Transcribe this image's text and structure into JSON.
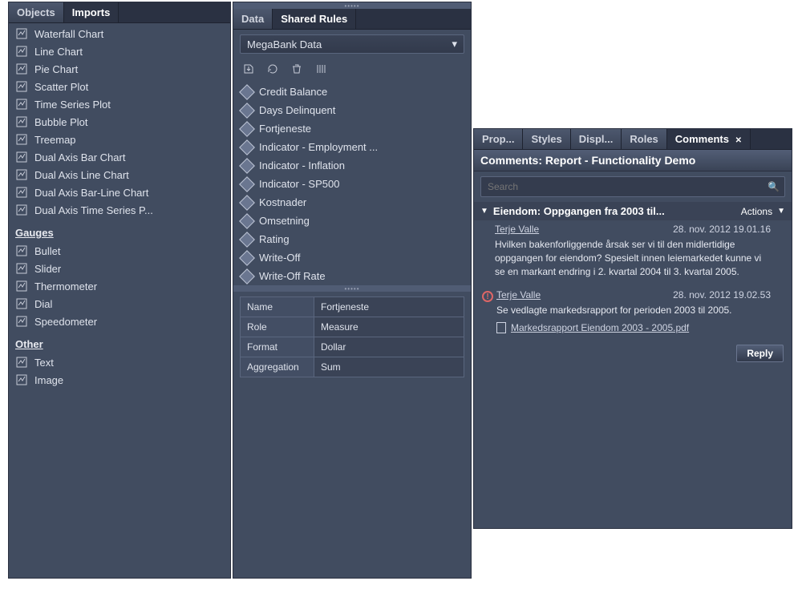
{
  "objects_panel": {
    "tabs": [
      {
        "label": "Objects",
        "active": false
      },
      {
        "label": "Imports",
        "active": true
      }
    ],
    "sections": [
      {
        "header": null,
        "items": [
          {
            "label": "Waterfall Chart",
            "icon": "waterfall-chart-icon"
          },
          {
            "label": "Line Chart",
            "icon": "line-chart-icon"
          },
          {
            "label": "Pie Chart",
            "icon": "pie-chart-icon"
          },
          {
            "label": "Scatter Plot",
            "icon": "scatter-plot-icon"
          },
          {
            "label": "Time Series Plot",
            "icon": "time-series-icon"
          },
          {
            "label": "Bubble Plot",
            "icon": "bubble-plot-icon"
          },
          {
            "label": "Treemap",
            "icon": "treemap-icon"
          },
          {
            "label": "Dual Axis Bar Chart",
            "icon": "dual-bar-icon"
          },
          {
            "label": "Dual Axis Line Chart",
            "icon": "dual-line-icon"
          },
          {
            "label": "Dual Axis Bar-Line Chart",
            "icon": "dual-barline-icon"
          },
          {
            "label": "Dual Axis Time Series P...",
            "icon": "dual-time-icon"
          }
        ]
      },
      {
        "header": "Gauges",
        "items": [
          {
            "label": "Bullet",
            "icon": "bullet-icon"
          },
          {
            "label": "Slider",
            "icon": "slider-icon"
          },
          {
            "label": "Thermometer",
            "icon": "thermometer-icon"
          },
          {
            "label": "Dial",
            "icon": "dial-icon"
          },
          {
            "label": "Speedometer",
            "icon": "speedometer-icon"
          }
        ]
      },
      {
        "header": "Other",
        "items": [
          {
            "label": "Text",
            "icon": "text-icon"
          },
          {
            "label": "Image",
            "icon": "image-icon"
          }
        ]
      }
    ]
  },
  "data_panel": {
    "tabs": [
      {
        "label": "Data",
        "active": false
      },
      {
        "label": "Shared Rules",
        "active": true
      }
    ],
    "datasource": "MegaBank Data",
    "toolbar_icons": [
      "export-icon",
      "refresh-icon",
      "trash-icon",
      "columns-icon"
    ],
    "items": [
      "Credit Balance",
      "Days Delinquent",
      "Fortjeneste",
      "Indicator - Employment ...",
      "Indicator - Inflation",
      "Indicator - SP500",
      "Kostnader",
      "Omsetning",
      "Rating",
      "Write-Off",
      "Write-Off Rate"
    ],
    "props": [
      {
        "name": "Name",
        "value": "Fortjeneste"
      },
      {
        "name": "Role",
        "value": "Measure"
      },
      {
        "name": "Format",
        "value": "Dollar"
      },
      {
        "name": "Aggregation",
        "value": "Sum"
      }
    ]
  },
  "comments_panel": {
    "tabs": [
      {
        "label": "Prop...",
        "active": false
      },
      {
        "label": "Styles",
        "active": false
      },
      {
        "label": "Displ...",
        "active": false
      },
      {
        "label": "Roles",
        "active": false
      },
      {
        "label": "Comments",
        "active": true,
        "closable": true
      }
    ],
    "title": "Comments: Report - Functionality Demo",
    "search_placeholder": "Search",
    "thread": {
      "title": "Eiendom: Oppgangen fra 2003 til...",
      "actions_label": "Actions"
    },
    "comments": [
      {
        "author": "Terje Valle",
        "date": "28. nov. 2012 19.01.16",
        "body": "Hvilken bakenforliggende årsak ser vi til den midlertidige oppgangen for eiendom? Spesielt innen leiemarkedet kunne vi se en markant endring i 2. kvartal 2004 til 3. kvartal 2005.",
        "alert": false
      },
      {
        "author": "Terje Valle",
        "date": "28. nov. 2012 19.02.53",
        "body": "Se vedlagte markedsrapport for perioden 2003 til 2005.",
        "alert": true,
        "attachment": "Markedsrapport Eiendom 2003 - 2005.pdf"
      }
    ],
    "reply_label": "Reply"
  }
}
